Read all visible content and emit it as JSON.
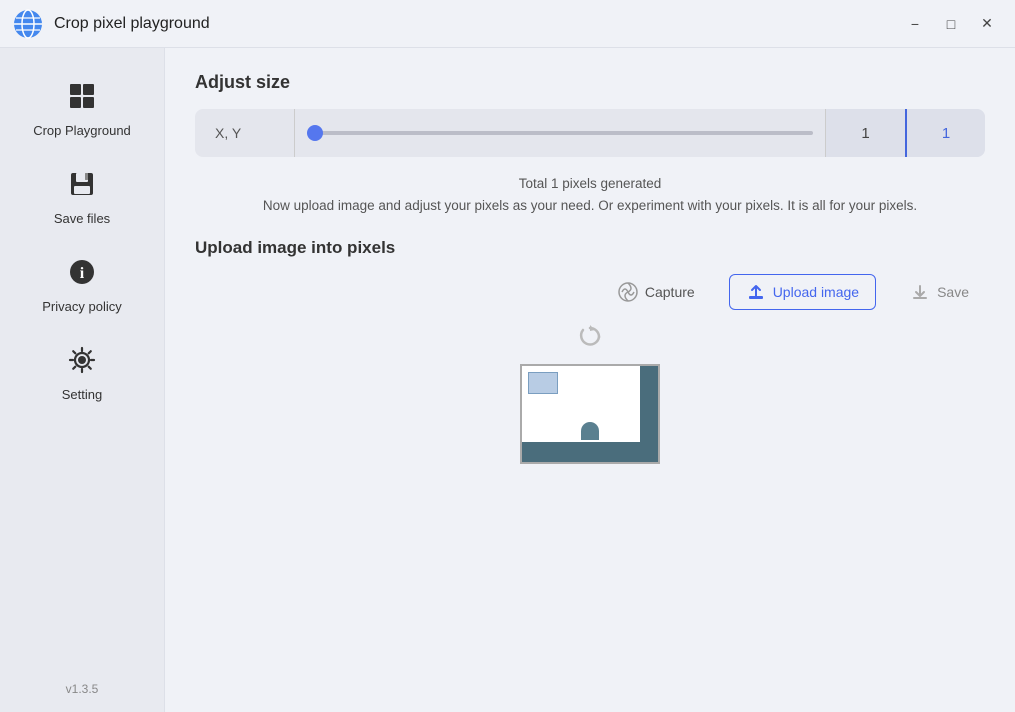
{
  "titlebar": {
    "title": "Crop pixel playground",
    "minimize_label": "−",
    "maximize_label": "□",
    "close_label": "✕"
  },
  "sidebar": {
    "items": [
      {
        "id": "crop-playground",
        "label": "Crop Playground",
        "icon": "⊞"
      },
      {
        "id": "save-files",
        "label": "Save files",
        "icon": "💾"
      },
      {
        "id": "privacy-policy",
        "label": "Privacy policy",
        "icon": "ℹ"
      },
      {
        "id": "setting",
        "label": "Setting",
        "icon": "⚙"
      }
    ],
    "version": "v1.3.5"
  },
  "content": {
    "adjust_size_title": "Adjust size",
    "slider": {
      "label": "X, Y",
      "value1": "1",
      "value2": "1"
    },
    "info_line1": "Total 1 pixels generated",
    "info_line2": "Now upload image and adjust your pixels as your need. Or experiment with your pixels. It is all for your pixels.",
    "upload_section_title": "Upload image into pixels",
    "toolbar": {
      "capture_label": "Capture",
      "upload_label": "Upload image",
      "save_label": "Save"
    }
  }
}
